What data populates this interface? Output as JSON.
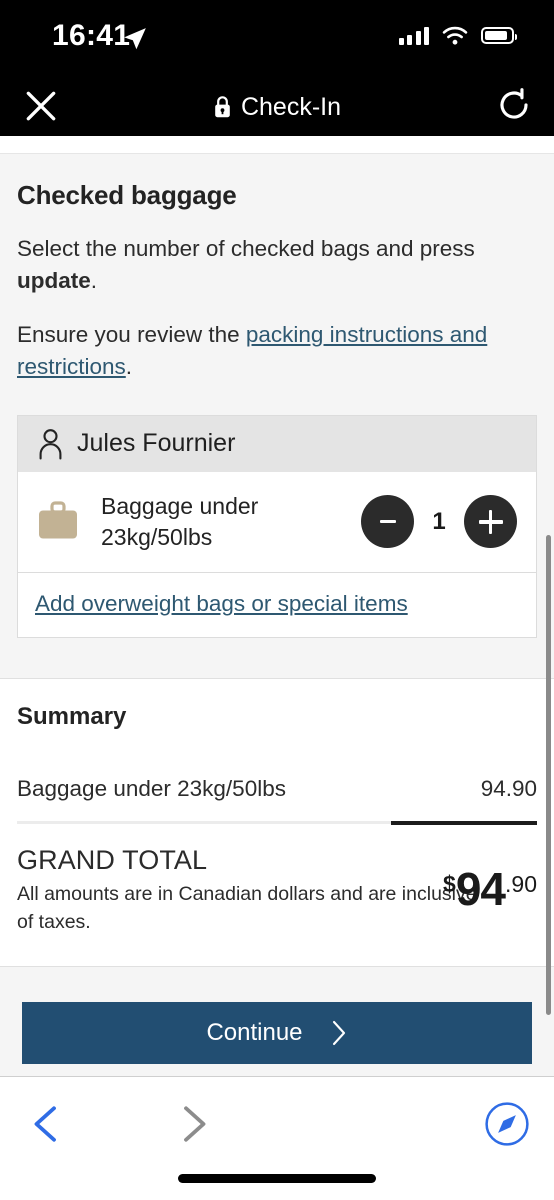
{
  "status_bar": {
    "time": "16:41",
    "location_icon": "location-arrow-icon",
    "signal_icon": "cellular-signal-icon",
    "wifi_icon": "wifi-icon",
    "battery_icon": "battery-icon"
  },
  "nav_bar": {
    "close_icon": "close-icon",
    "lock_icon": "lock-icon",
    "title": "Check-In",
    "reload_icon": "reload-icon"
  },
  "content": {
    "heading": "Checked baggage",
    "instruction_prefix": "Select the number of checked bags and press ",
    "instruction_bold": "update",
    "instruction_suffix": ".",
    "ensure_prefix": "Ensure you review the ",
    "ensure_link": "packing instructions and restrictions",
    "ensure_suffix": "."
  },
  "passenger_card": {
    "person_icon": "person-icon",
    "name": "Jules Fournier",
    "bag_icon": "suitcase-icon",
    "bag_label": "Baggage under 23kg/50lbs",
    "decrement_label": "-",
    "increment_label": "+",
    "quantity": "1",
    "special_items_link": "Add overweight bags or special items"
  },
  "summary": {
    "title": "Summary",
    "rows": [
      {
        "label": "Baggage under 23kg/50lbs",
        "amount": "94.90"
      }
    ],
    "grand_total_label": "GRAND TOTAL",
    "grand_total_note": "All amounts are in Canadian dollars and are inclusive of taxes.",
    "currency_symbol": "$",
    "total_whole": "94",
    "total_cents": ".90"
  },
  "cta": {
    "label": "Continue",
    "chevron_icon": "chevron-right-icon"
  },
  "browser_bar": {
    "back_icon": "chevron-left-icon",
    "forward_icon": "chevron-right-icon",
    "safari_icon": "safari-compass-icon"
  },
  "colors": {
    "cta_blue": "#224e72",
    "link_blue": "#2e5871",
    "suitcase_tan": "#c2b294",
    "stepper_dark": "#2b2b2b",
    "card_header_grey": "#e4e4e4",
    "section_grey": "#f5f5f5",
    "safari_blue": "#2f6ce5"
  }
}
